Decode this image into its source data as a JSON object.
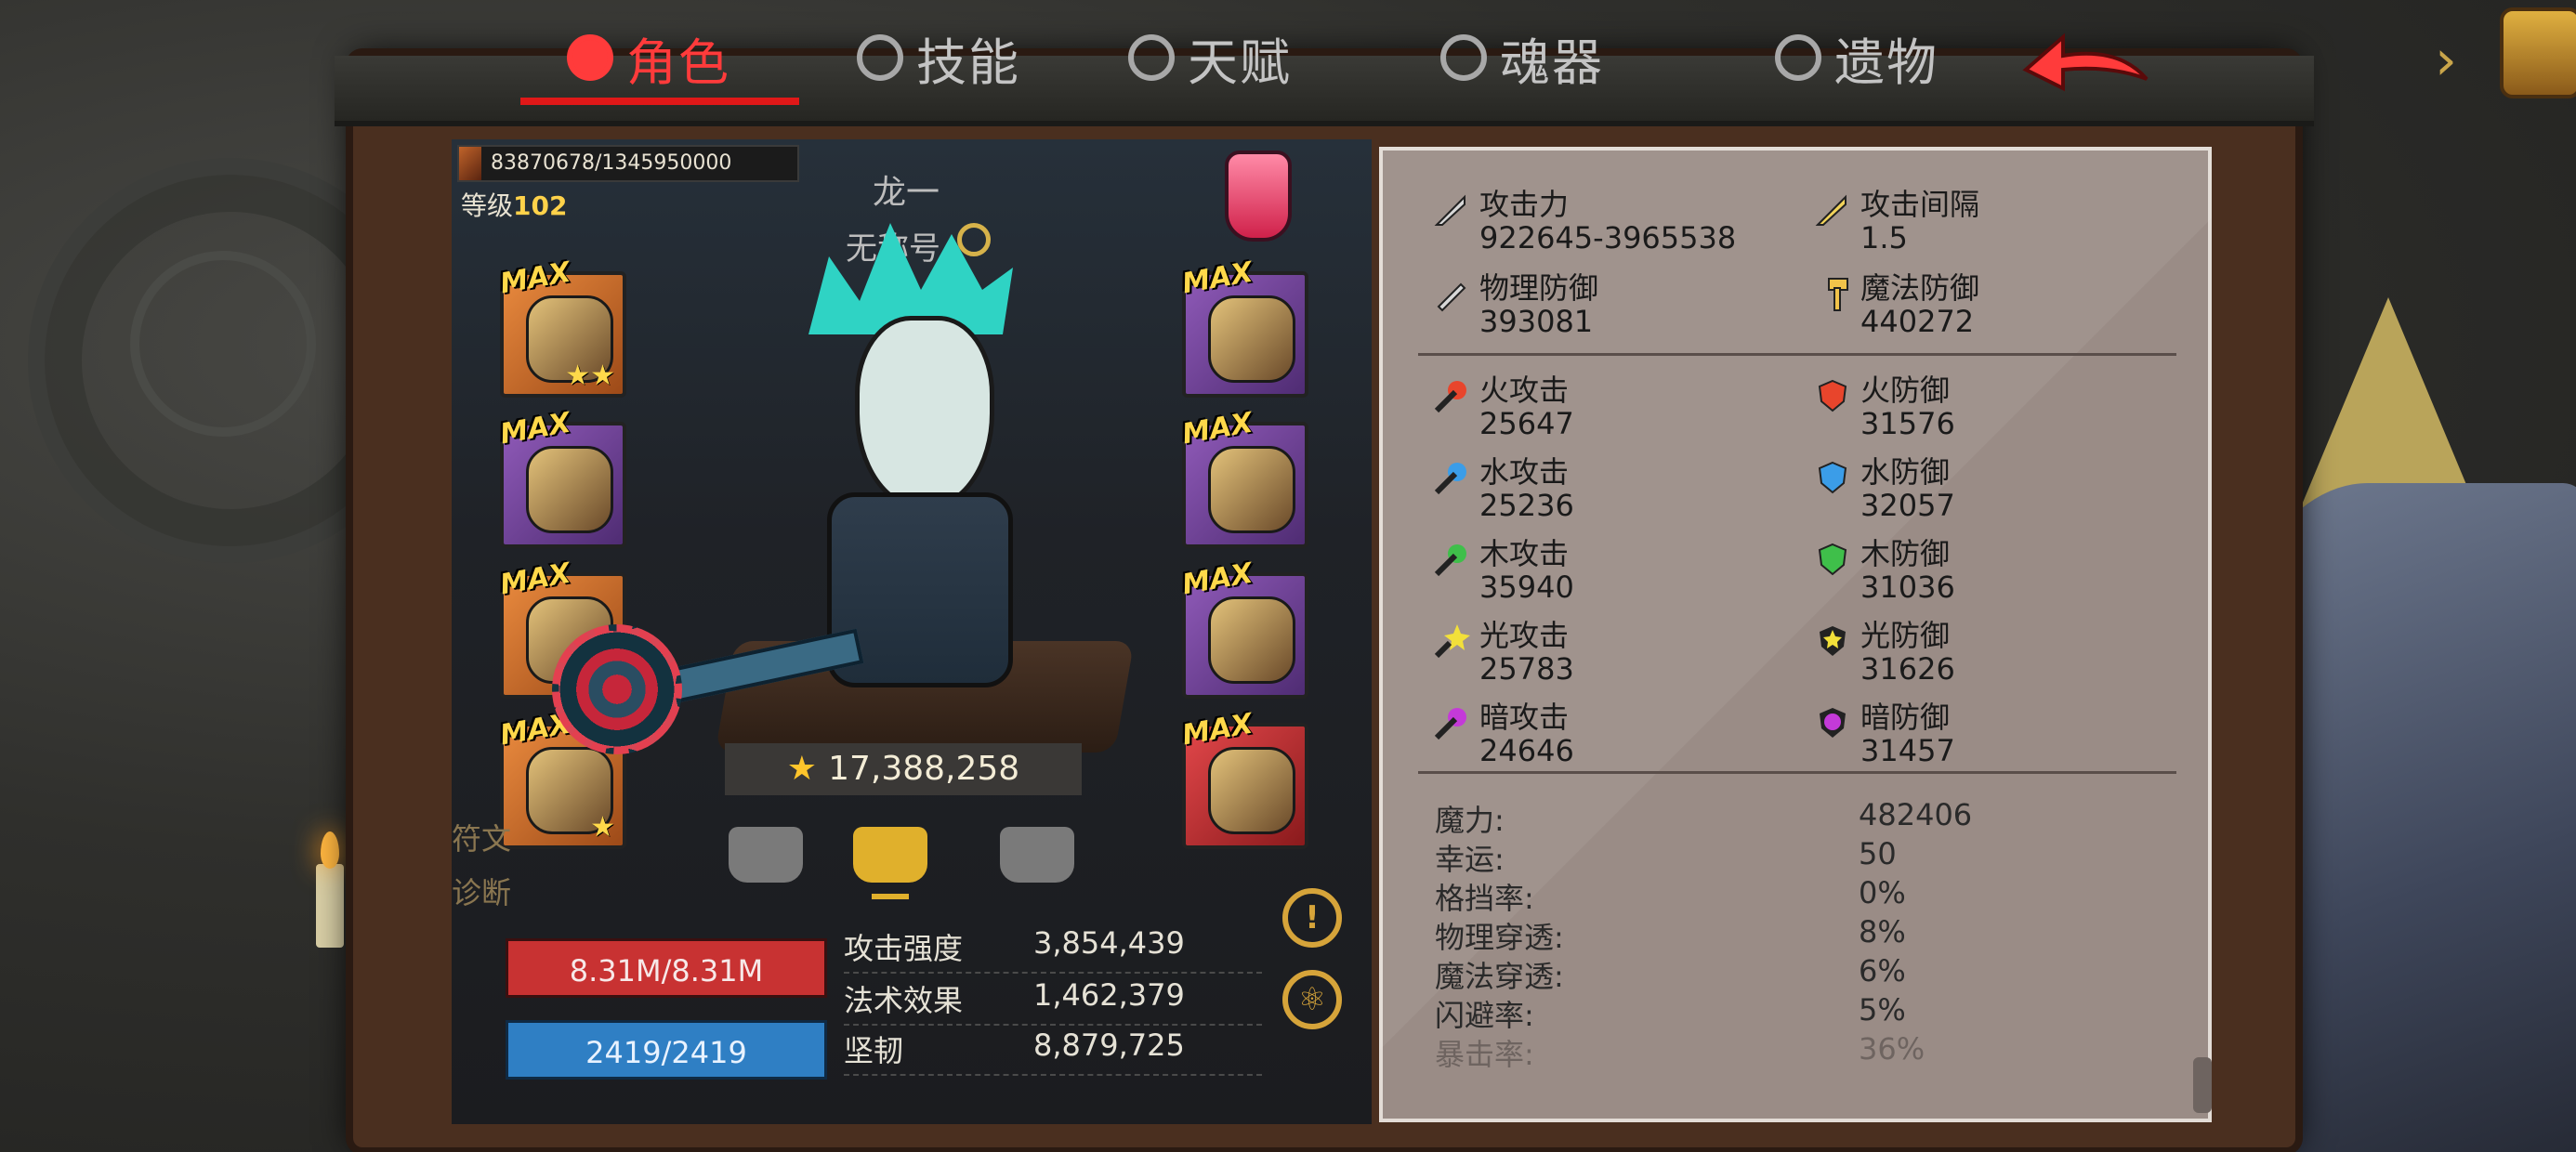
{
  "tabs": [
    {
      "label": "角色",
      "icon": "helmet-icon",
      "active": true
    },
    {
      "label": "技能",
      "icon": "skill-icon",
      "active": false
    },
    {
      "label": "天赋",
      "icon": "talent-icon",
      "active": false
    },
    {
      "label": "魂器",
      "icon": "soul-icon",
      "active": false
    },
    {
      "label": "遗物",
      "icon": "relic-icon",
      "active": false
    }
  ],
  "exp": "83870678/1345950000",
  "level": {
    "label": "等级",
    "value": "102"
  },
  "character": {
    "name": "龙一",
    "title": "无称号"
  },
  "power": "17,388,258",
  "side_labels": {
    "rune": "符文",
    "diagnose": "诊断"
  },
  "bars": {
    "hp": "8.31M/8.31M",
    "mp": "2419/2419"
  },
  "stats": [
    {
      "label": "攻击强度",
      "value": "3,854,439"
    },
    {
      "label": "法术效果",
      "value": "1,462,379"
    },
    {
      "label": "坚韧",
      "value": "8,879,725"
    }
  ],
  "slots": {
    "max": "MAX"
  },
  "attributes": {
    "attack": {
      "label": "攻击力",
      "value": "922645-3965538"
    },
    "interval": {
      "label": "攻击间隔",
      "value": "1.5"
    },
    "phys_def": {
      "label": "物理防御",
      "value": "393081"
    },
    "magic_def": {
      "label": "魔法防御",
      "value": "440272"
    },
    "fire_atk": {
      "label": "火攻击",
      "value": "25647"
    },
    "fire_def": {
      "label": "火防御",
      "value": "31576"
    },
    "water_atk": {
      "label": "水攻击",
      "value": "25236"
    },
    "water_def": {
      "label": "水防御",
      "value": "32057"
    },
    "wood_atk": {
      "label": "木攻击",
      "value": "35940"
    },
    "wood_def": {
      "label": "木防御",
      "value": "31036"
    },
    "light_atk": {
      "label": "光攻击",
      "value": "25783"
    },
    "light_def": {
      "label": "光防御",
      "value": "31626"
    },
    "dark_atk": {
      "label": "暗攻击",
      "value": "24646"
    },
    "dark_def": {
      "label": "暗防御",
      "value": "31457"
    }
  },
  "misc_stats": [
    {
      "label": "魔力:",
      "value": "482406"
    },
    {
      "label": "幸运:",
      "value": "50"
    },
    {
      "label": "格挡率:",
      "value": "0%"
    },
    {
      "label": "物理穿透:",
      "value": "8%"
    },
    {
      "label": "魔法穿透:",
      "value": "6%"
    },
    {
      "label": "闪避率:",
      "value": "5%"
    },
    {
      "label": "暴击率:",
      "value": "36%"
    }
  ],
  "colors": {
    "accent": "#ff3b3b",
    "gold": "#ffd24a",
    "hp": "#c83232",
    "mp": "#2f7fc4",
    "panel": "#9a8c86"
  }
}
